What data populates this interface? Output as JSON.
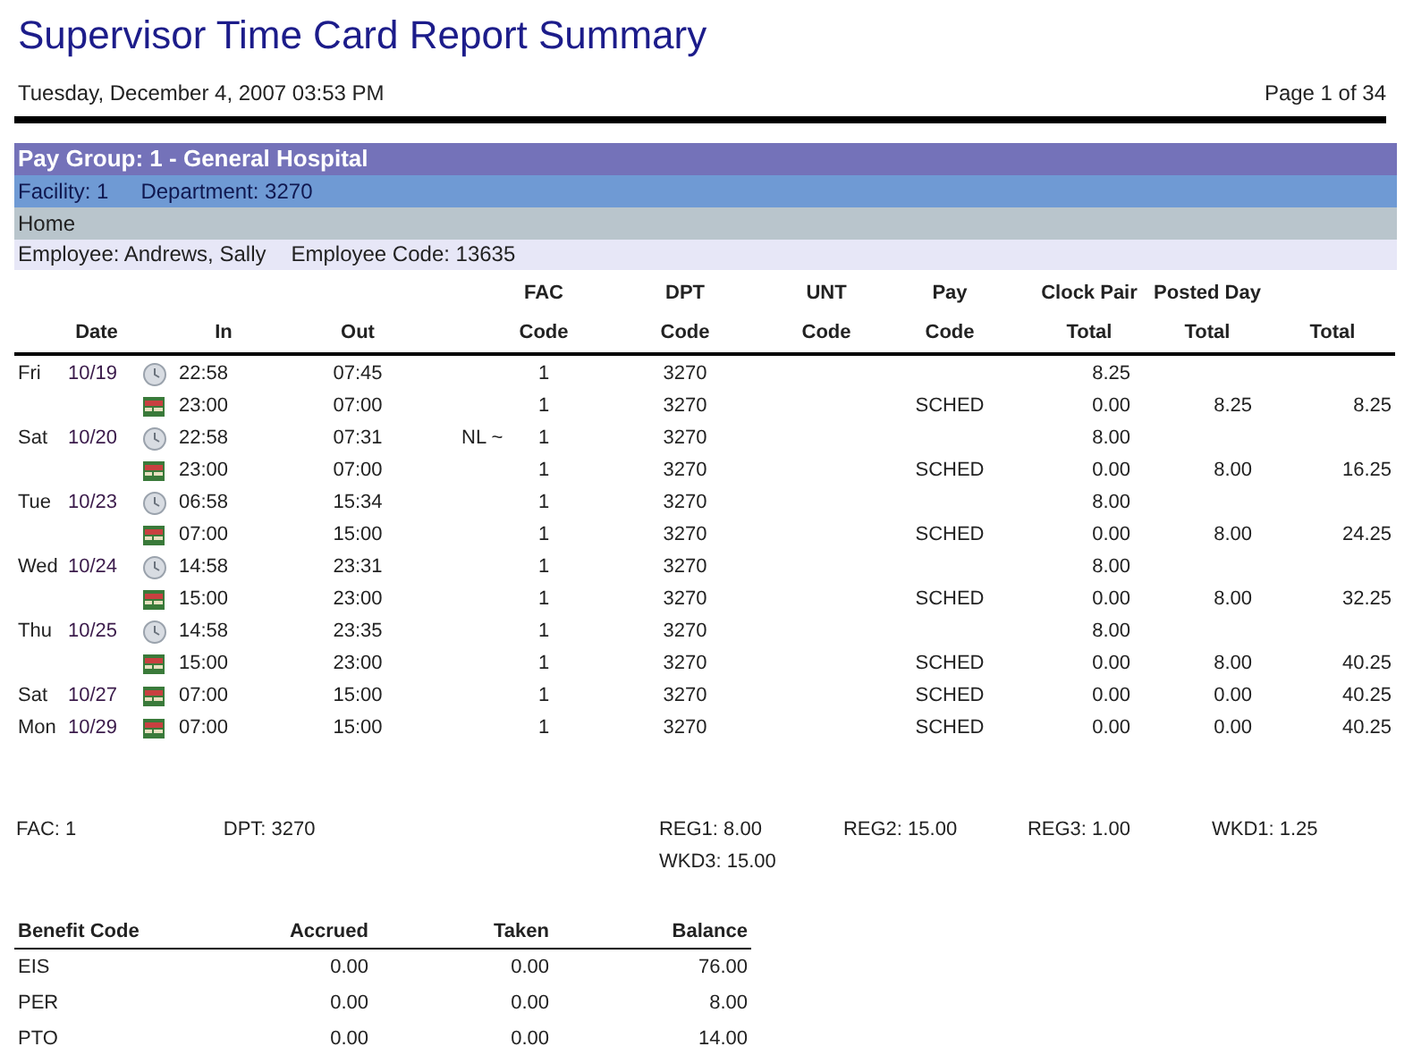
{
  "report": {
    "title": "Supervisor Time Card Report Summary",
    "timestamp": "Tuesday, December 4, 2007 03:53 PM",
    "page": "Page 1 of 34"
  },
  "groups": {
    "pay_group": "Pay Group: 1 - General Hospital",
    "facility": "Facility: 1",
    "department": "Department: 3270",
    "home": "Home",
    "employee": "Employee: Andrews, Sally",
    "employee_code": "Employee Code: 13635"
  },
  "table": {
    "columns": [
      {
        "bottom": "Date"
      },
      {
        "bottom": "In"
      },
      {
        "bottom": "Out"
      },
      {
        "top": "FAC",
        "bottom": "Code"
      },
      {
        "top": "DPT",
        "bottom": "Code"
      },
      {
        "top": "UNT",
        "bottom": "Code"
      },
      {
        "top": "Pay",
        "bottom": "Code"
      },
      {
        "top": "Clock Pair",
        "bottom": "Total"
      },
      {
        "top": "Posted Day",
        "bottom": "Total"
      },
      {
        "bottom": "Total"
      }
    ],
    "rows": [
      {
        "day": "Fri",
        "date": "10/19",
        "kind": "clock",
        "in": "22:58",
        "out": "07:45",
        "fac": "1",
        "dpt": "3270",
        "clock_pair_total": "8.25"
      },
      {
        "kind": "schedule",
        "in": "23:00",
        "out": "07:00",
        "fac": "1",
        "dpt": "3270",
        "pay_code": "SCHED",
        "clock_pair_total": "0.00",
        "posted_day_total": "8.25",
        "total": "8.25"
      },
      {
        "day": "Sat",
        "date": "10/20",
        "kind": "clock",
        "in": "22:58",
        "out": "07:31",
        "note": "NL ~",
        "fac": "1",
        "dpt": "3270",
        "clock_pair_total": "8.00"
      },
      {
        "kind": "schedule",
        "in": "23:00",
        "out": "07:00",
        "fac": "1",
        "dpt": "3270",
        "pay_code": "SCHED",
        "clock_pair_total": "0.00",
        "posted_day_total": "8.00",
        "total": "16.25"
      },
      {
        "day": "Tue",
        "date": "10/23",
        "kind": "clock",
        "in": "06:58",
        "out": "15:34",
        "fac": "1",
        "dpt": "3270",
        "clock_pair_total": "8.00"
      },
      {
        "kind": "schedule",
        "in": "07:00",
        "out": "15:00",
        "fac": "1",
        "dpt": "3270",
        "pay_code": "SCHED",
        "clock_pair_total": "0.00",
        "posted_day_total": "8.00",
        "total": "24.25"
      },
      {
        "day": "Wed",
        "date": "10/24",
        "kind": "clock",
        "in": "14:58",
        "out": "23:31",
        "fac": "1",
        "dpt": "3270",
        "clock_pair_total": "8.00"
      },
      {
        "kind": "schedule",
        "in": "15:00",
        "out": "23:00",
        "fac": "1",
        "dpt": "3270",
        "pay_code": "SCHED",
        "clock_pair_total": "0.00",
        "posted_day_total": "8.00",
        "total": "32.25"
      },
      {
        "day": "Thu",
        "date": "10/25",
        "kind": "clock",
        "in": "14:58",
        "out": "23:35",
        "fac": "1",
        "dpt": "3270",
        "clock_pair_total": "8.00"
      },
      {
        "kind": "schedule",
        "in": "15:00",
        "out": "23:00",
        "fac": "1",
        "dpt": "3270",
        "pay_code": "SCHED",
        "clock_pair_total": "0.00",
        "posted_day_total": "8.00",
        "total": "40.25"
      },
      {
        "day": "Sat",
        "date": "10/27",
        "kind": "schedule",
        "in": "07:00",
        "out": "15:00",
        "fac": "1",
        "dpt": "3270",
        "pay_code": "SCHED",
        "clock_pair_total": "0.00",
        "posted_day_total": "0.00",
        "total": "40.25"
      },
      {
        "day": "Mon",
        "date": "10/29",
        "kind": "schedule",
        "in": "07:00",
        "out": "15:00",
        "fac": "1",
        "dpt": "3270",
        "pay_code": "SCHED",
        "clock_pair_total": "0.00",
        "posted_day_total": "0.00",
        "total": "40.25"
      }
    ]
  },
  "summary": {
    "fac": "FAC: 1",
    "dpt": "DPT: 3270",
    "codes": [
      "REG1: 8.00",
      "REG2: 15.00",
      "REG3: 1.00",
      "WKD1: 1.25",
      "WKD3: 15.00"
    ]
  },
  "benefits": {
    "columns": [
      "Benefit Code",
      "Accrued",
      "Taken",
      "Balance"
    ],
    "rows": [
      {
        "code": "EIS",
        "accrued": "0.00",
        "taken": "0.00",
        "balance": "76.00"
      },
      {
        "code": "PER",
        "accrued": "0.00",
        "taken": "0.00",
        "balance": "8.00"
      },
      {
        "code": "PTO",
        "accrued": "0.00",
        "taken": "0.00",
        "balance": "14.00"
      }
    ]
  }
}
